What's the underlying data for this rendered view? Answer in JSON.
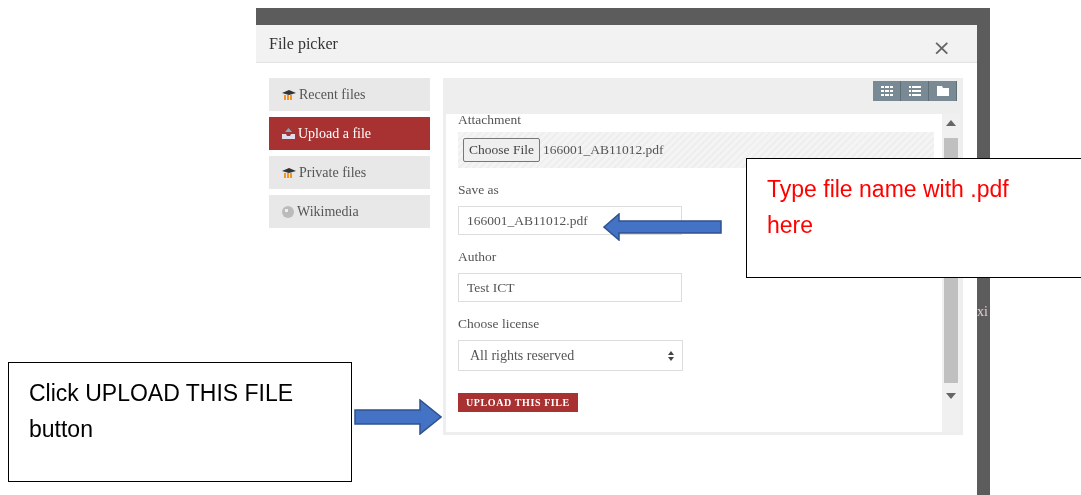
{
  "dialog": {
    "title": "File picker",
    "close": "×"
  },
  "sidebar": {
    "items": [
      {
        "label": "Recent files",
        "kind": "moodle",
        "selected": false
      },
      {
        "label": "Upload a file",
        "kind": "upload",
        "selected": true
      },
      {
        "label": "Private files",
        "kind": "moodle",
        "selected": false
      },
      {
        "label": "Wikimedia",
        "kind": "globe",
        "selected": false
      }
    ]
  },
  "form": {
    "attachment": {
      "label": "Attachment",
      "button": "Choose File",
      "file": "166001_AB11012.pdf"
    },
    "save_as": {
      "label": "Save as",
      "value": "166001_AB11012.pdf"
    },
    "author": {
      "label": "Author",
      "value": "Test ICT"
    },
    "license": {
      "label": "Choose license",
      "value": "All rights reserved"
    },
    "submit": "UPLOAD THIS FILE"
  },
  "backdrop_text": "xi",
  "callouts": [
    {
      "text": "Type file name with .pdf here",
      "color": "#ff0000"
    },
    {
      "text": "Click UPLOAD THIS FILE button",
      "color": "#000000"
    }
  ]
}
